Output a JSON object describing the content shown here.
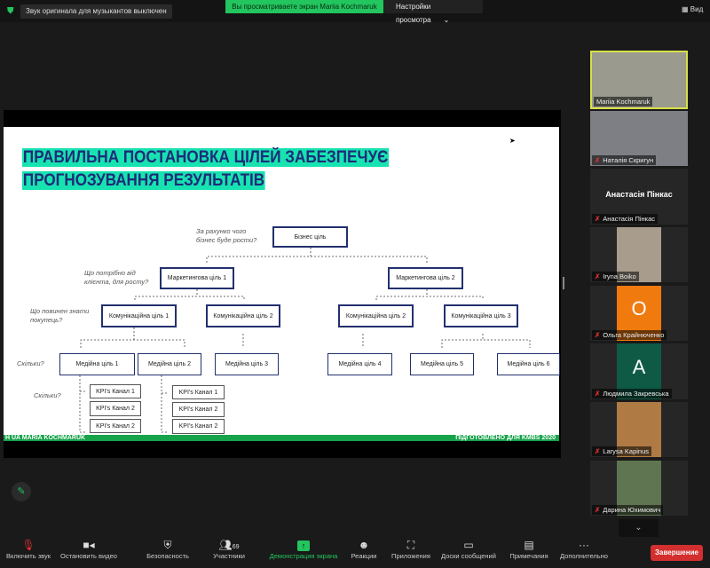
{
  "topbar": {
    "notice": "Звук оригинала для музыкантов выключен",
    "viewing": "Вы просматриваете экран Mariia Kochmaruk",
    "view_options": "Настройки просмотра",
    "view": "Вид"
  },
  "slide": {
    "title_line1": "ПРАВИЛЬНА ПОСТАНОВКА ЦІЛЕЙ ЗАБЕЗПЕЧУЄ",
    "title_line2": "ПРОГНОЗУВАННЯ РЕЗУЛЬТАТІВ",
    "questions": {
      "q1a": "За рахунко чого",
      "q1b": "бізнес буде рости?",
      "q2a": "Що потрібно від",
      "q2b": "клієнта, для росту?",
      "q3a": "Що повинен знати",
      "q3b": "покупець?",
      "q4": "Скільки?",
      "q5": "Скільки?"
    },
    "boxes": {
      "business": "Бізнес ціль",
      "m1": "Маркетингова ціль 1",
      "m2": "Маркетингова ціль 2",
      "c1": "Комунікаційна ціль 1",
      "c2a": "Комунікаційна ціль 2",
      "c2b": "Комунікаційна ціль 2",
      "c3": "Комунікаційна ціль 3",
      "md1": "Медійна ціль 1",
      "md2": "Медійна ціль 2",
      "md3": "Медійна ціль 3",
      "md4": "Медійна ціль 4",
      "md5": "Медійна ціль 5",
      "md6": "Медійна ціль 6"
    },
    "kpis_left": [
      "KPI's Канал 1",
      "KPI's Канал 2",
      "KPI's Канал 2"
    ],
    "kpis_right": [
      "KPI's Канал 1",
      "KPI's Канал 2",
      "KPI's Канал 2"
    ],
    "footer_left": "H  UA   MARIA KOCHMARUK",
    "footer_right": "ПІДГОТОВЛЕНО ДЛЯ KMBS  2020"
  },
  "participants": [
    {
      "name": "Mariia Kochmaruk",
      "initial": "",
      "color": "#9a9a8e"
    },
    {
      "name": "Наталія  Скригун",
      "initial": "",
      "color": "#7d7f84"
    },
    {
      "name": "Анастасія Пінкас",
      "initial": "",
      "color": ""
    },
    {
      "name": "Iryna Boiko",
      "initial": "",
      "color": "#a89c8c"
    },
    {
      "name": "Ольга Крайнюченко",
      "initial": "O",
      "color": "#f07a0e"
    },
    {
      "name": "Людмила Закревська",
      "initial": "A",
      "color": "#0e5a45"
    },
    {
      "name": "Larysa Kapinus",
      "initial": "",
      "color": "#b07a45"
    },
    {
      "name": "Дарина Юхимович",
      "initial": "",
      "color": "#5f7450"
    }
  ],
  "toolbar": {
    "unmute": "Включить звук",
    "video": "Остановить видео",
    "security": "Безопасность",
    "participants": "Участники",
    "participants_count": "69",
    "share": "Демонстрация экрана",
    "reactions": "Реакции",
    "apps": "Приложения",
    "whiteboards": "Доски сообщений",
    "notes": "Примечания",
    "more": "Дополнительно",
    "end": "Завершение"
  }
}
